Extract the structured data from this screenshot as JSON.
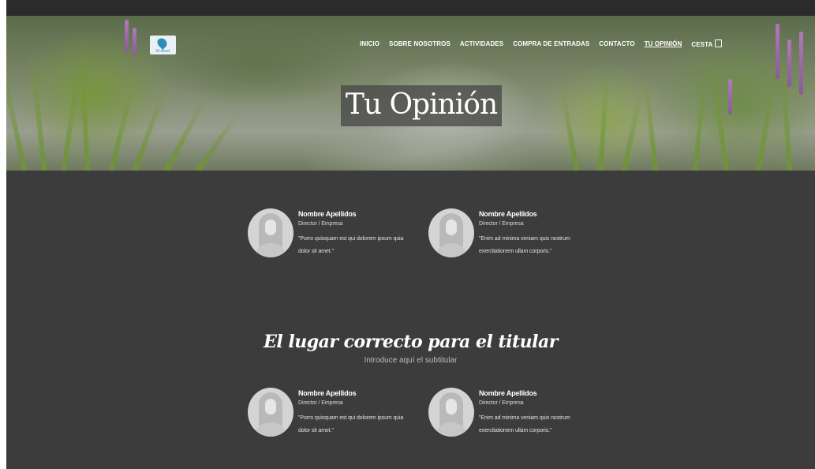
{
  "header": {
    "logo_text": "El Azud",
    "nav": [
      {
        "label": "INICIO",
        "active": false
      },
      {
        "label": "SOBRE NOSOTROS",
        "active": false
      },
      {
        "label": "ACTIVIDADES",
        "active": false
      },
      {
        "label": "COMPRA DE ENTRADAS",
        "active": false
      },
      {
        "label": "CONTACTO",
        "active": false
      },
      {
        "label": "TU OPINIÓN",
        "active": true
      },
      {
        "label": "CESTA",
        "active": false
      }
    ],
    "cart_icon": "cart-icon"
  },
  "hero": {
    "title": "Tu Opinión"
  },
  "section": {
    "headline": "El lugar correcto para el titular",
    "subheadline": "Introduce aquí el subtitular"
  },
  "testimonials": [
    {
      "name": "Nombre Apellidos",
      "role": "Director / Empresa",
      "quote": "\"Porro quisquam est qui dolorem ipsum quia dolor sit amet.\""
    },
    {
      "name": "Nombre Apellidos",
      "role": "Director / Empresa",
      "quote": "\"Enim ad minima veniam quis nostrum exercitationem ullam corporis.\""
    },
    {
      "name": "Nombre Apellidos",
      "role": "Director / Empresa",
      "quote": "\"Porro quisquam est qui dolorem ipsum quia dolor sit amet.\""
    },
    {
      "name": "Nombre Apellidos",
      "role": "Director / Empresa",
      "quote": "\"Enim ad minima veniam quis nostrum exercitationem ullam corporis.\""
    }
  ],
  "colors": {
    "content_bg": "#3c3c3c",
    "topbar_bg": "#2b2b2b",
    "accent": "#2d8fb8"
  }
}
